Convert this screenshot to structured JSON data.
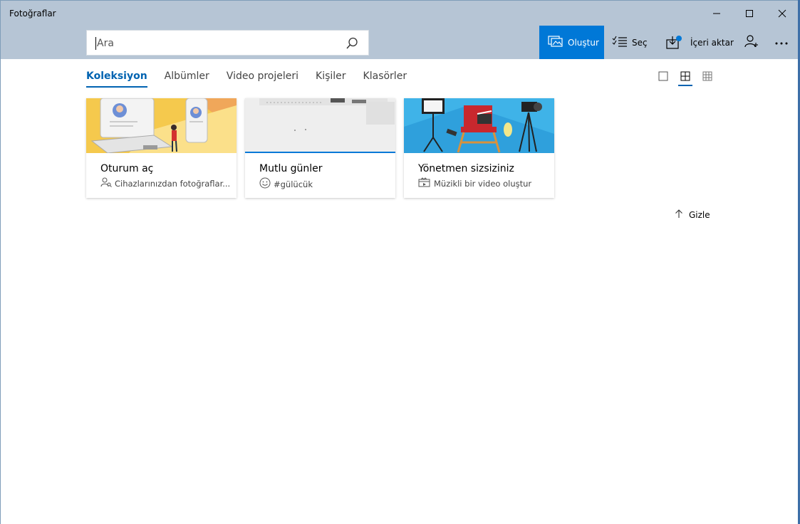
{
  "window": {
    "title": "Fotoğraflar"
  },
  "search": {
    "placeholder": "Ara"
  },
  "toolbar": {
    "create_label": "Oluştur",
    "select_label": "Seç",
    "import_label": "İçeri aktar"
  },
  "tabs": [
    {
      "label": "Koleksiyon",
      "active": true
    },
    {
      "label": "Albümler"
    },
    {
      "label": "Video projeleri"
    },
    {
      "label": "Kişiler"
    },
    {
      "label": "Klasörler"
    }
  ],
  "cards": [
    {
      "title": "Oturum aç",
      "subtitle": "Cihazlarınızdan fotoğraflar..."
    },
    {
      "title": "Mutlu günler",
      "subtitle": "#gülücük"
    },
    {
      "title": "Yönetmen sizsiziniz",
      "subtitle": "Müzikli bir video oluştur"
    }
  ],
  "hide": {
    "label": "Gizle"
  },
  "colors": {
    "accent": "#0078d7",
    "titlebar": "#b6c5d5"
  }
}
